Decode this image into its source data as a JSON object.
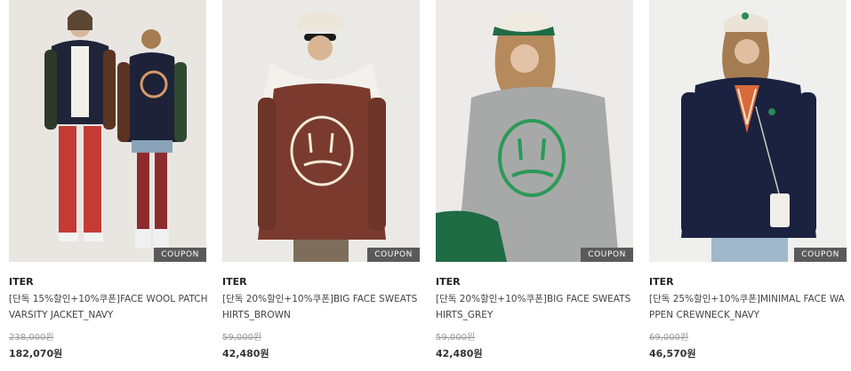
{
  "products": [
    {
      "brand": "ITER",
      "name": "[단독 15%할인+10%쿠폰]FACE WOOL PATCH VARSITY JACKET_NAVY",
      "original_price": "238,000원",
      "sale_price": "182,070원",
      "badge": "COUPON",
      "image_alt": "varsity-jacket-photo"
    },
    {
      "brand": "ITER",
      "name": "[단독 20%할인+10%쿠폰]BIG FACE SWEATSHIRTS_BROWN",
      "original_price": "59,000원",
      "sale_price": "42,480원",
      "badge": "COUPON",
      "image_alt": "brown-sweatshirt-photo"
    },
    {
      "brand": "ITER",
      "name": "[단독 20%할인+10%쿠폰]BIG FACE SWEATSHIRTS_GREY",
      "original_price": "59,000원",
      "sale_price": "42,480원",
      "badge": "COUPON",
      "image_alt": "grey-sweatshirt-photo"
    },
    {
      "brand": "ITER",
      "name": "[단독 25%할인+10%쿠폰]MINIMAL FACE WAPPEN CREWNECK_NAVY",
      "original_price": "69,000원",
      "sale_price": "46,570원",
      "badge": "COUPON",
      "image_alt": "navy-crewneck-photo"
    }
  ]
}
